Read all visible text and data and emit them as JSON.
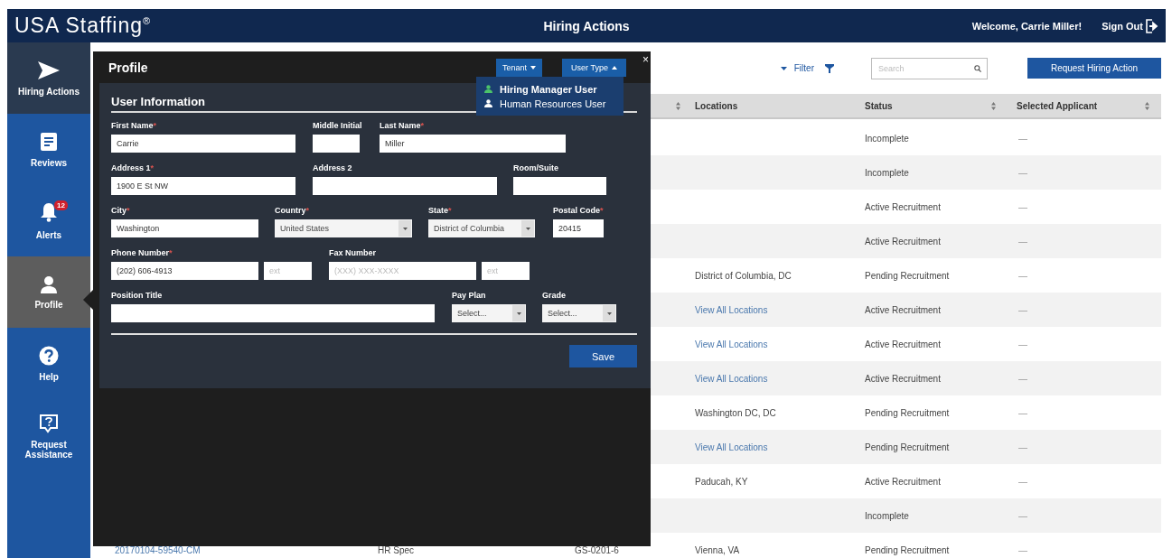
{
  "header": {
    "logo": "USA Staffing$^{®}$",
    "title": "Hiring Actions",
    "welcome": "Welcome, Carrie Miller!",
    "sign_out": "Sign Out"
  },
  "sidebar": {
    "items": [
      {
        "label": "Hiring Actions",
        "selected": false,
        "current": true
      },
      {
        "label": "Reviews",
        "selected": false,
        "current": false
      },
      {
        "label": "Alerts",
        "badge": "12",
        "selected": false,
        "current": false
      },
      {
        "label": "Profile",
        "selected": true,
        "current": false
      },
      {
        "label": "Help",
        "selected": false,
        "current": false
      },
      {
        "label": "Request Assistance",
        "selected": false,
        "current": false
      }
    ]
  },
  "toolbar": {
    "filter": "Filter",
    "search": {
      "placeholder": "Search"
    },
    "request_button": "Request Hiring Action"
  },
  "table": {
    "columns": [
      {
        "label": "Locations"
      },
      {
        "label": "Status"
      },
      {
        "label": "Selected Applicant"
      }
    ],
    "rows": [
      {
        "status": "Incomplete",
        "applicant": "—"
      },
      {
        "status": "Incomplete",
        "applicant": "—"
      },
      {
        "status": "Active Recruitment",
        "applicant": "—"
      },
      {
        "status": "Active Recruitment",
        "applicant": "—"
      },
      {
        "location": "District of Columbia, DC",
        "location_link": false,
        "status": "Pending Recruitment",
        "applicant": "—"
      },
      {
        "location": "View All Locations",
        "location_link": true,
        "status": "Active Recruitment",
        "applicant": "—"
      },
      {
        "location": "View All Locations",
        "location_link": true,
        "status": "Active Recruitment",
        "applicant": "—"
      },
      {
        "location": "View All Locations",
        "location_link": true,
        "status": "Active Recruitment",
        "applicant": "—"
      },
      {
        "location": "Washington DC, DC",
        "location_link": false,
        "status": "Pending Recruitment",
        "applicant": "—"
      },
      {
        "location": "View All Locations",
        "location_link": true,
        "status": "Pending Recruitment",
        "applicant": "—"
      },
      {
        "location": "Paducah, KY",
        "location_link": false,
        "status": "Active Recruitment",
        "applicant": "—"
      },
      {
        "status": "Incomplete",
        "applicant": "—"
      },
      {
        "column_1": "20170104-59540-CM",
        "column_2": "HR Spec",
        "column_3": "GS-0201-6",
        "location": "Vienna, VA",
        "location_link": false,
        "status": "Pending Recruitment",
        "applicant": "—"
      }
    ]
  },
  "modal": {
    "title": "Profile",
    "tenant_button": {
      "label": "Tenant",
      "expanded": false
    },
    "user_type_button": {
      "label": "User Type",
      "expanded": true
    },
    "close": "×",
    "menu": [
      {
        "label": "Hiring Manager User",
        "selected": true
      },
      {
        "label": "Human Resources User",
        "selected": false
      }
    ],
    "section_title": "User Information",
    "fields": [
      {
        "label": "First Name",
        "required_mark": "*",
        "kind": "text",
        "value": "Carrie"
      },
      {
        "label": "Middle Initial",
        "kind": "text"
      },
      {
        "label": "Last Name",
        "required_mark": "*",
        "kind": "text",
        "value": "Miller"
      },
      {
        "label": "Address 1",
        "required_mark": "*",
        "kind": "text",
        "value": "1900 E St NW"
      },
      {
        "label": "Address 2",
        "kind": "text"
      },
      {
        "label": "Room/Suite",
        "kind": "text"
      },
      {
        "label": "City",
        "required_mark": "*",
        "kind": "text",
        "value": "Washington"
      },
      {
        "label": "Country",
        "required_mark": "*",
        "kind": "select",
        "value": "United States"
      },
      {
        "label": "State",
        "required_mark": "*",
        "kind": "select",
        "value": "District of Columbia"
      },
      {
        "label": "Postal Code",
        "required_mark": "*",
        "kind": "text",
        "value": "20415"
      },
      {
        "label": "Phone Number",
        "required_mark": "*",
        "kind": "text",
        "value": "(202) 606-4913"
      },
      {
        "kind": "text",
        "placeholder": "ext"
      },
      {
        "label": "Fax Number",
        "kind": "text",
        "placeholder": "(XXX) XXX-XXXX"
      },
      {
        "kind": "text",
        "placeholder": "ext"
      },
      {
        "label": "Position Title",
        "kind": "text"
      },
      {
        "label": "Pay Plan",
        "kind": "select",
        "value": "Select..."
      },
      {
        "label": "Grade",
        "kind": "select",
        "value": "Select..."
      }
    ],
    "save": "Save"
  }
}
